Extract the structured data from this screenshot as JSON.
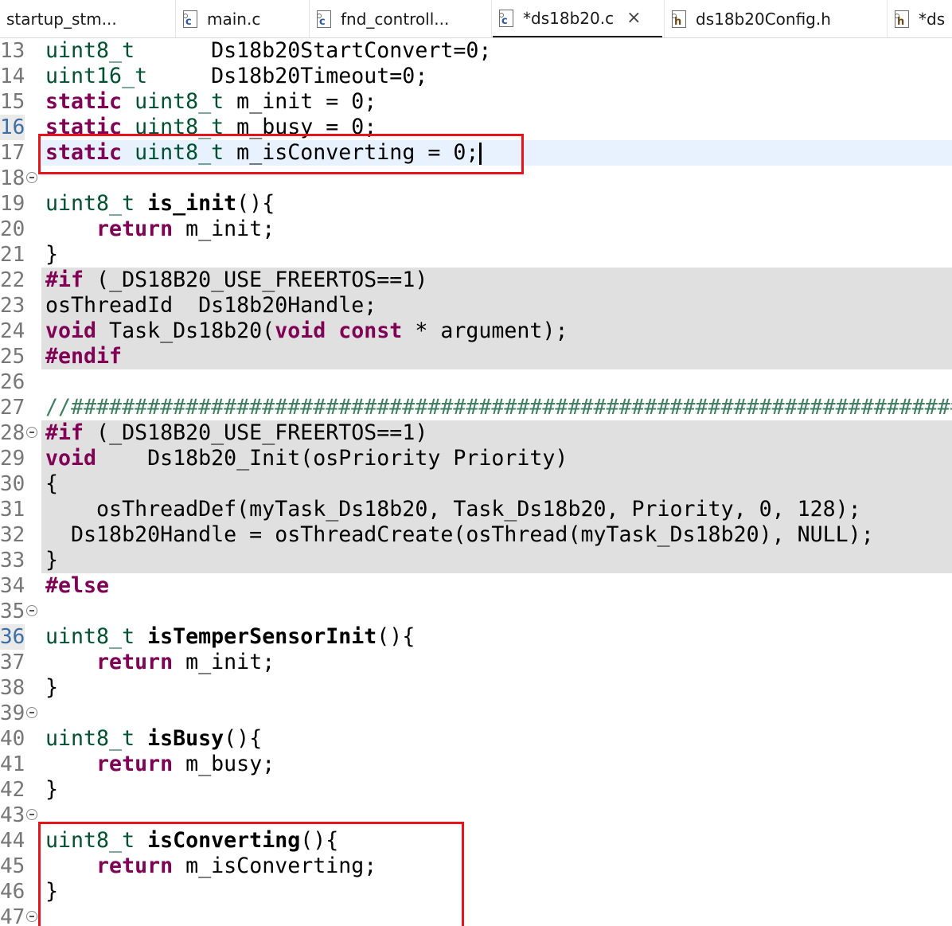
{
  "tabs": [
    {
      "label": "startup_stm...",
      "icon": "none",
      "active": false
    },
    {
      "label": "main.c",
      "icon": "c",
      "active": false
    },
    {
      "label": "fnd_controll...",
      "icon": "c",
      "active": false
    },
    {
      "label": "*ds18b20.c",
      "icon": "c",
      "active": true
    },
    {
      "label": "ds18b20Config.h",
      "icon": "h",
      "active": false
    },
    {
      "label": "*ds",
      "icon": "h",
      "active": false
    }
  ],
  "icon_glyphs": {
    "c": "c",
    "h": "h"
  },
  "close_glyph": "×",
  "colors": {
    "keyword": "#7f0055",
    "type": "#005032",
    "comment": "#3f7f5f",
    "inactive_bg": "#e0e0e0",
    "current_line_bg": "#e8f2fe",
    "annotation": "#e8141c"
  },
  "lines": [
    {
      "n": "13",
      "tokens": [
        [
          "ty",
          "uint8_t"
        ],
        [
          "pl",
          "      Ds18b20StartConvert=0;"
        ]
      ]
    },
    {
      "n": "14",
      "tokens": [
        [
          "ty",
          "uint16_t"
        ],
        [
          "pl",
          "     Ds18b20Timeout=0;"
        ]
      ]
    },
    {
      "n": "15",
      "tokens": [
        [
          "kw",
          "static"
        ],
        [
          "pl",
          " "
        ],
        [
          "ty",
          "uint8_t"
        ],
        [
          "pl",
          " m_init = 0;"
        ]
      ]
    },
    {
      "n": "16",
      "hl": true,
      "tokens": [
        [
          "kw",
          "static"
        ],
        [
          "pl",
          " "
        ],
        [
          "ty",
          "uint8_t"
        ],
        [
          "pl",
          " m_busy = 0;"
        ]
      ]
    },
    {
      "n": "17",
      "current": true,
      "caret": true,
      "tokens": [
        [
          "kw",
          "static"
        ],
        [
          "pl",
          " "
        ],
        [
          "ty",
          "uint8_t"
        ],
        [
          "pl",
          " m_isConverting = 0;"
        ]
      ]
    },
    {
      "n": "18",
      "fold": true,
      "tokens": []
    },
    {
      "n": "19",
      "tokens": [
        [
          "ty",
          "uint8_t"
        ],
        [
          "pl",
          " "
        ],
        [
          "fn",
          "is_init"
        ],
        [
          "pl",
          "(){"
        ]
      ]
    },
    {
      "n": "20",
      "tokens": [
        [
          "pl",
          "    "
        ],
        [
          "kw",
          "return"
        ],
        [
          "pl",
          " m_init;"
        ]
      ]
    },
    {
      "n": "21",
      "tokens": [
        [
          "pl",
          "}"
        ]
      ]
    },
    {
      "n": "22",
      "inactive": true,
      "tokens": [
        [
          "pp",
          "#if"
        ],
        [
          "pl",
          " (_DS18B20_USE_FREERTOS==1)"
        ]
      ]
    },
    {
      "n": "23",
      "inactive": true,
      "tokens": [
        [
          "pl",
          "osThreadId  Ds18b20Handle;"
        ]
      ]
    },
    {
      "n": "24",
      "inactive": true,
      "tokens": [
        [
          "kw",
          "void"
        ],
        [
          "pl",
          " Task_Ds18b20("
        ],
        [
          "kw",
          "void"
        ],
        [
          "pl",
          " "
        ],
        [
          "kw",
          "const"
        ],
        [
          "pl",
          " * argument);"
        ]
      ]
    },
    {
      "n": "25",
      "inactive": true,
      "tokens": [
        [
          "pp",
          "#endif"
        ]
      ]
    },
    {
      "n": "26",
      "tokens": []
    },
    {
      "n": "27",
      "tokens": [
        [
          "cm",
          "//#######################################################################"
        ]
      ]
    },
    {
      "n": "28",
      "fold": true,
      "inactive": true,
      "tokens": [
        [
          "pp",
          "#if"
        ],
        [
          "pl",
          " (_DS18B20_USE_FREERTOS==1)"
        ]
      ]
    },
    {
      "n": "29",
      "inactive": true,
      "tokens": [
        [
          "kw",
          "void"
        ],
        [
          "pl",
          "    Ds18b20_Init(osPriority Priority)"
        ]
      ]
    },
    {
      "n": "30",
      "inactive": true,
      "tokens": [
        [
          "pl",
          "{"
        ]
      ]
    },
    {
      "n": "31",
      "inactive": true,
      "tokens": [
        [
          "pl",
          "    osThreadDef(myTask_Ds18b20, Task_Ds18b20, Priority, 0, 128);"
        ]
      ]
    },
    {
      "n": "32",
      "inactive": true,
      "tokens": [
        [
          "pl",
          "  Ds18b20Handle = osThreadCreate(osThread(myTask_Ds18b20), NULL);"
        ]
      ]
    },
    {
      "n": "33",
      "inactive": true,
      "tokens": [
        [
          "pl",
          "}"
        ]
      ]
    },
    {
      "n": "34",
      "tokens": [
        [
          "pp",
          "#else"
        ]
      ]
    },
    {
      "n": "35",
      "fold": true,
      "tokens": []
    },
    {
      "n": "36",
      "hl": true,
      "tokens": [
        [
          "ty",
          "uint8_t"
        ],
        [
          "pl",
          " "
        ],
        [
          "fn",
          "isTemperSensorInit"
        ],
        [
          "pl",
          "(){"
        ]
      ]
    },
    {
      "n": "37",
      "tokens": [
        [
          "pl",
          "    "
        ],
        [
          "kw",
          "return"
        ],
        [
          "pl",
          " m_init;"
        ]
      ]
    },
    {
      "n": "38",
      "tokens": [
        [
          "pl",
          "}"
        ]
      ]
    },
    {
      "n": "39",
      "fold": true,
      "tokens": []
    },
    {
      "n": "40",
      "tokens": [
        [
          "ty",
          "uint8_t"
        ],
        [
          "pl",
          " "
        ],
        [
          "fn",
          "isBusy"
        ],
        [
          "pl",
          "(){"
        ]
      ]
    },
    {
      "n": "41",
      "tokens": [
        [
          "pl",
          "    "
        ],
        [
          "kw",
          "return"
        ],
        [
          "pl",
          " m_busy;"
        ]
      ]
    },
    {
      "n": "42",
      "tokens": [
        [
          "pl",
          "}"
        ]
      ]
    },
    {
      "n": "43",
      "fold": true,
      "tokens": []
    },
    {
      "n": "44",
      "tokens": [
        [
          "ty",
          "uint8_t"
        ],
        [
          "pl",
          " "
        ],
        [
          "fn",
          "isConverting"
        ],
        [
          "pl",
          "(){"
        ]
      ]
    },
    {
      "n": "45",
      "tokens": [
        [
          "pl",
          "    "
        ],
        [
          "kw",
          "return"
        ],
        [
          "pl",
          " m_isConverting;"
        ]
      ]
    },
    {
      "n": "46",
      "tokens": [
        [
          "pl",
          "}"
        ]
      ]
    },
    {
      "n": "47",
      "fold": true,
      "tokens": []
    }
  ],
  "annotations": [
    {
      "label": "highlight-m-isconverting-declaration",
      "from_line": "17",
      "to_line": "17"
    },
    {
      "label": "highlight-isconverting-function",
      "from_line": "44",
      "to_line": "47"
    }
  ]
}
